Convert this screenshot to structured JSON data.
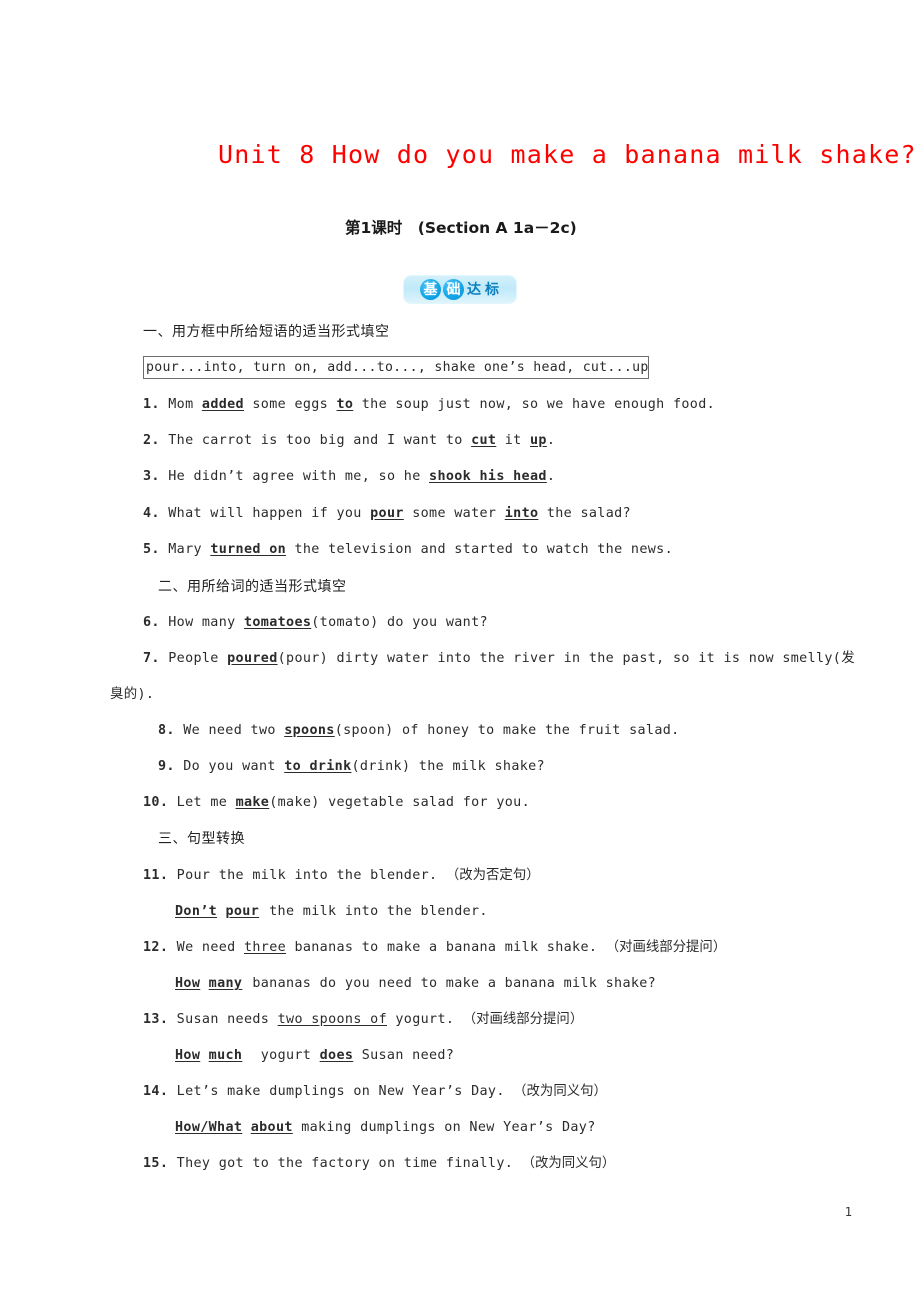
{
  "document": {
    "title": "Unit 8  How do you make a banana milk shake?",
    "title_color": "#ff0000",
    "subtitle": "第1课时　(Section A 1a－2c)",
    "page_number": "1"
  },
  "badge": {
    "char1": "基",
    "char2": "础",
    "char3": "达",
    "char4": "标",
    "bg_color": "#c9edfa",
    "circle_color": "#14a7e8",
    "text_color": "#0b7fbf"
  },
  "sections": [
    {
      "heading": "一、用方框中所给短语的适当形式填空",
      "wordbank": "pour...into, turn on, add...to..., shake one’s head, cut...up"
    },
    {
      "heading": "二、用所给词的适当形式填空"
    },
    {
      "heading": "三、句型转换"
    }
  ],
  "questions": {
    "q1": {
      "num": "1.",
      "pre": "Mom ",
      "ans1": "added",
      "mid1": " some eggs ",
      "ans2": "to",
      "post": " the soup just now, so we have enough food."
    },
    "q2": {
      "num": "2.",
      "pre": "The carrot is too big and I want to ",
      "ans1": "cut",
      "mid1": " it ",
      "ans2": "up",
      "post": "."
    },
    "q3": {
      "num": "3.",
      "pre": "He didn’t agree with me, so he ",
      "ans1": "shook his head",
      "post": "."
    },
    "q4": {
      "num": "4.",
      "pre": "What will happen if you ",
      "ans1": "pour",
      "mid1": " some water ",
      "ans2": "into",
      "post": " the salad?"
    },
    "q5": {
      "num": "5.",
      "pre": "Mary ",
      "ans1": "turned on",
      "post": " the television and started to watch the news."
    },
    "q6": {
      "num": "6.",
      "pre": "How many ",
      "ans1": "tomatoes",
      "post": "(tomato) do you want?"
    },
    "q7": {
      "num": "7.",
      "pre": "People ",
      "ans1": "poured",
      "post": "(pour) dirty water into the river in the past, so it is now smelly(发",
      "wrap": "臭的)."
    },
    "q8": {
      "num": "8.",
      "pre": "We need two ",
      "ans1": "spoons",
      "post": "(spoon) of honey to make the fruit salad."
    },
    "q9": {
      "num": "9.",
      "pre": "Do you want ",
      "ans1": "to drink",
      "post": "(drink) the milk shake?"
    },
    "q10": {
      "num": "10.",
      "pre": "Let me ",
      "ans1": "make",
      "post": "(make) vegetable salad for you."
    },
    "q11": {
      "num": "11.",
      "prompt": "Pour the milk into the blender.",
      "tag": "（改为否定句）",
      "ans1": "Don’t",
      "ans2": "pour",
      "answer_post": "the milk into the blender."
    },
    "q12": {
      "num": "12.",
      "pre": "We need ",
      "underlined": "three",
      "post": " bananas to make a banana milk shake.",
      "tag": "（对画线部分提问）",
      "ans1": "How",
      "ans2": "many",
      "answer_post": "bananas do you need to make a banana milk shake?"
    },
    "q13": {
      "num": "13.",
      "pre": "Susan needs ",
      "underlined": "two spoons of",
      "post": " yogurt.",
      "tag": "（对画线部分提问）",
      "ans1": "How",
      "ans2": "much",
      "answer_mid": " yogurt ",
      "ans3": "does",
      "answer_post": " Susan need?"
    },
    "q14": {
      "num": "14.",
      "prompt": "Let’s make dumplings on New Year’s Day.",
      "tag": "（改为同义句）",
      "ans1": "How/What",
      "ans2": "about",
      "answer_post": " making dumplings on New Year’s Day?"
    },
    "q15": {
      "num": "15.",
      "prompt": "They got to the factory on time finally.",
      "tag": "（改为同义句）"
    }
  }
}
